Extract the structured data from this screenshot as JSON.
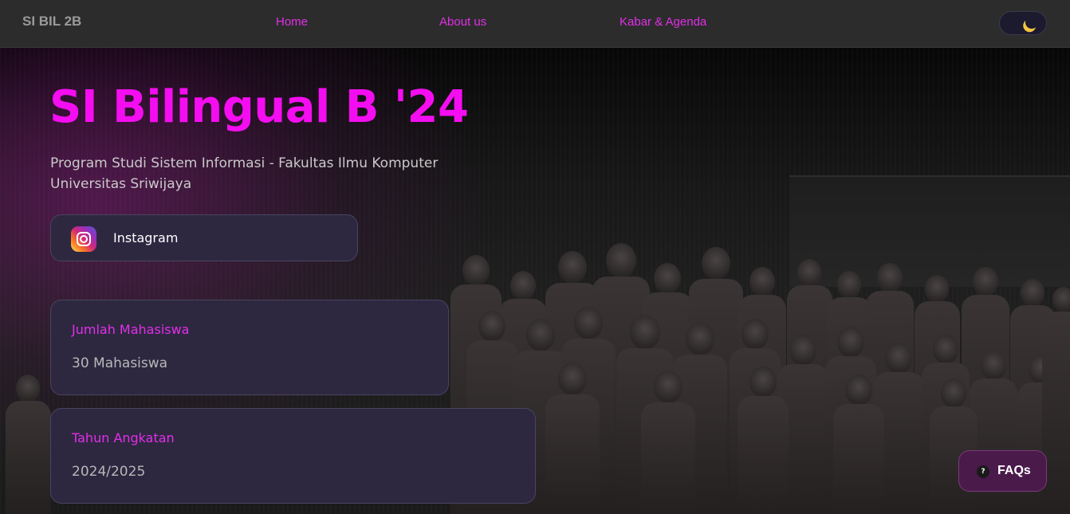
{
  "navbar": {
    "brand": "SI BIL 2B",
    "links": [
      {
        "label": "Home"
      },
      {
        "label": "About us"
      },
      {
        "label": "Kabar & Agenda"
      }
    ],
    "theme_toggle_icon": "moon-icon"
  },
  "hero": {
    "title": "SI Bilingual B '24",
    "subtitle_line1": "Program Studi Sistem Informasi - Fakultas Ilmu Komputer",
    "subtitle_line2": "Universitas Sriwijaya",
    "instagram_label": "Instagram",
    "instagram_icon": "instagram-icon"
  },
  "stats": [
    {
      "label": "Jumlah Mahasiswa",
      "value": "30 Mahasiswa"
    },
    {
      "label": "Tahun Angkatan",
      "value": "2024/2025"
    }
  ],
  "faq": {
    "icon_glyph": "?",
    "label": "FAQs"
  },
  "colors": {
    "accent": "#f40df0",
    "link": "#e22fe8",
    "card_bg": "#2d2840",
    "navbar_bg": "#2c2c2c"
  }
}
